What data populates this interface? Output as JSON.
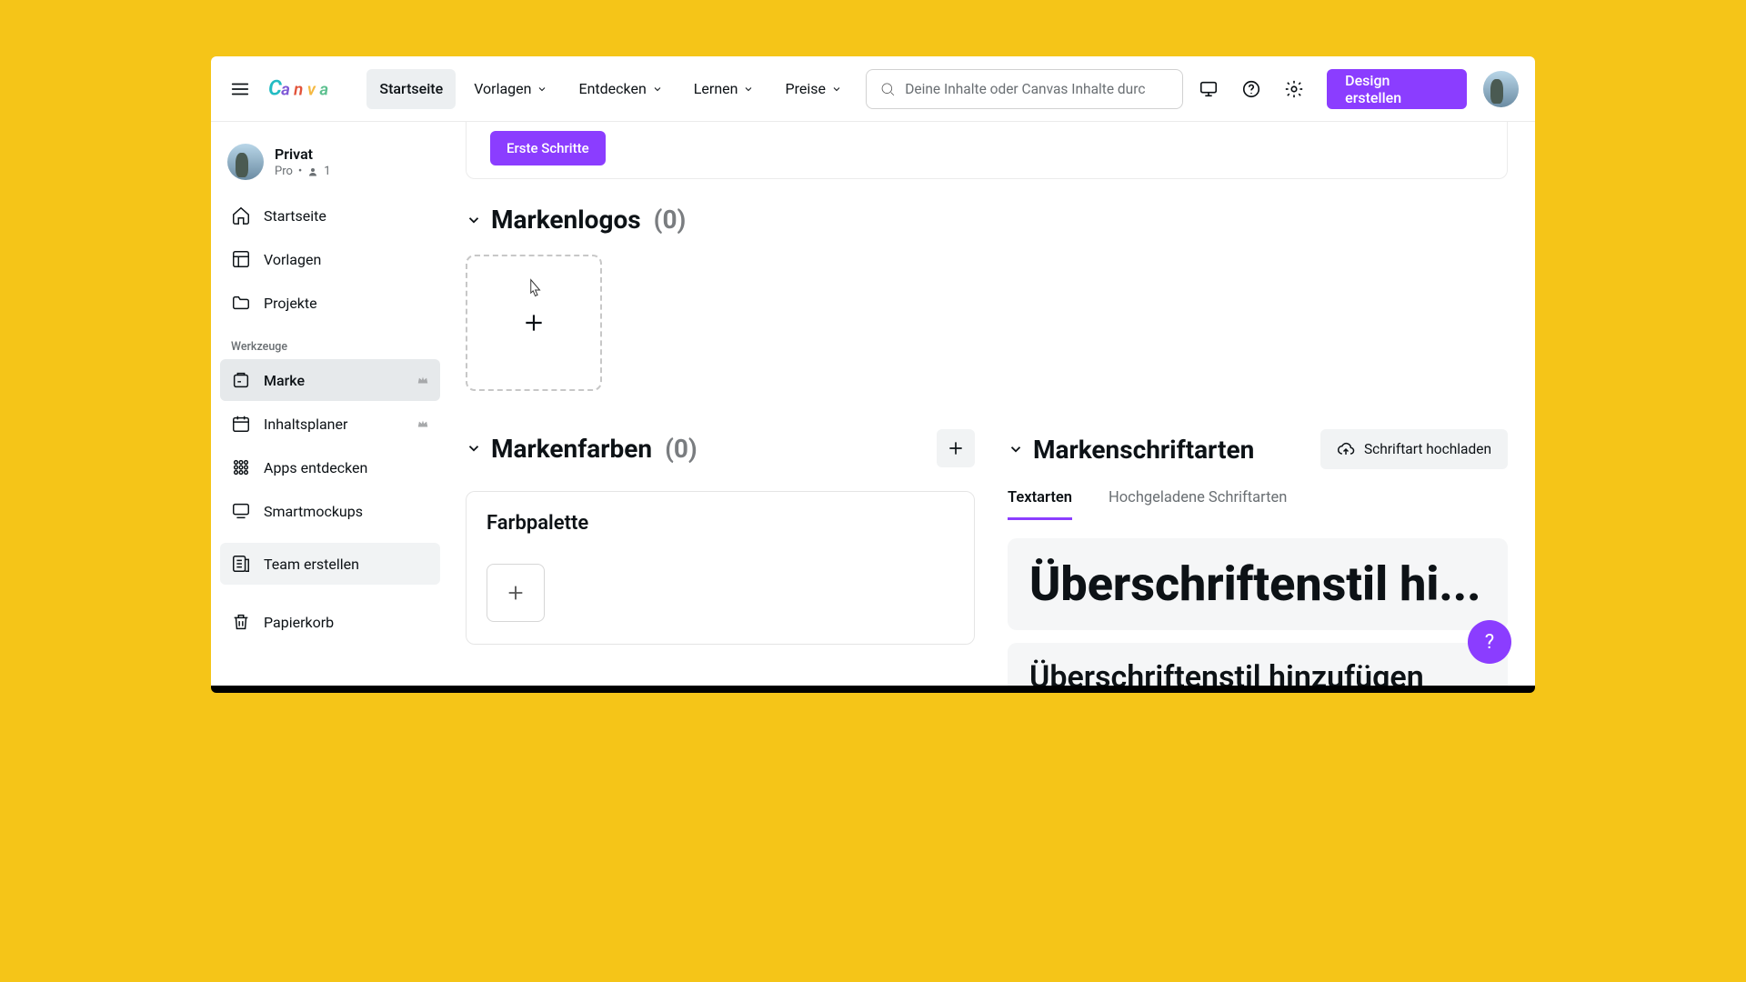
{
  "nav": {
    "home": "Startseite",
    "templates": "Vorlagen",
    "discover": "Entdecken",
    "learn": "Lernen",
    "pricing": "Preise",
    "cta": "Design erstellen"
  },
  "search": {
    "placeholder": "Deine Inhalte oder Canvas Inhalte durc"
  },
  "profile": {
    "name": "Privat",
    "plan": "Pro",
    "members": "1"
  },
  "sidebar": {
    "home": "Startseite",
    "templates": "Vorlagen",
    "projects": "Projekte",
    "tools_heading": "Werkzeuge",
    "brand": "Marke",
    "content_planner": "Inhaltsplaner",
    "discover_apps": "Apps entdecken",
    "smartmockups": "Smartmockups",
    "create_team": "Team erstellen",
    "trash": "Papierkorb"
  },
  "onboarding": {
    "cta": "Erste Schritte"
  },
  "sections": {
    "logos_title": "Markenlogos",
    "logos_count": "(0)",
    "colors_title": "Markenfarben",
    "colors_count": "(0)",
    "fonts_title": "Markenschriftarten",
    "upload_font": "Schriftart hochladen",
    "palette_title": "Farbpalette"
  },
  "font_tabs": {
    "styles": "Textarten",
    "uploaded": "Hochgeladene Schriftarten"
  },
  "font_cards": {
    "heading_big": "Überschriftenstil hi...",
    "heading_small": "Überschriftenstil hinzufügen"
  },
  "fab": "?"
}
